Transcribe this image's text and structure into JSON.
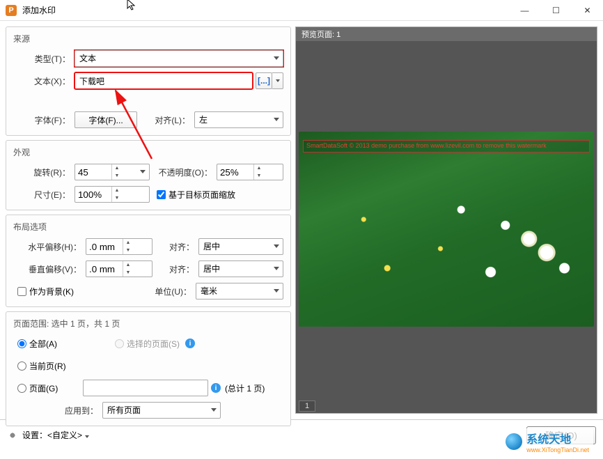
{
  "window": {
    "title": "添加水印",
    "icon_letter": "P",
    "minimize": "—",
    "maximize": "☐",
    "close": "✕"
  },
  "source": {
    "group": "来源",
    "type_label": "类型(T)：",
    "type_value": "文本",
    "text_label": "文本(X)：",
    "text_value": "下载吧",
    "ext_btn": "[...]",
    "font_label": "字体(F)：",
    "font_btn": "字体(F)...",
    "align_label": "对齐(L)：",
    "align_value": "左"
  },
  "appearance": {
    "group": "外观",
    "rotate_label": "旋转(R)：",
    "rotate_value": "45",
    "opacity_label": "不透明度(O)：",
    "opacity_value": "25%",
    "size_label": "尺寸(E)：",
    "size_value": "100%",
    "scale_check": "基于目标页面缩放",
    "scale_checked": true
  },
  "layout": {
    "group": "布局选项",
    "hoffset_label": "水平偏移(H)：",
    "hoffset_value": ".0 mm",
    "voffset_label": "垂直偏移(V)：",
    "voffset_value": ".0 mm",
    "halign_label": "对齐：",
    "halign_value": "居中",
    "valign_label": "对齐：",
    "valign_value": "居中",
    "bg_check": "作为背景(K)",
    "bg_checked": false,
    "unit_label": "单位(U)：",
    "unit_value": "毫米"
  },
  "range": {
    "group": "页面范围: 选中 1 页，共 1 页",
    "all": "全部(A)",
    "current": "当前页(R)",
    "pages": "页面(G)",
    "selected": "选择的页面(S)",
    "pages_value": "",
    "pages_hint": "(总计 1 页)",
    "apply_label": "应用到：",
    "apply_value": "所有页面",
    "checked": "all"
  },
  "preview": {
    "header": "预览页面: 1",
    "watermark_text": "SmartDataSoft © 2013 demo purchase from www.lizevil.com to remove this watermark",
    "page_num": "1"
  },
  "footer": {
    "settings_label": "设置：<自定义>",
    "ok": "确定(O)"
  },
  "branding": {
    "name": "系统天地",
    "url": "www.XiTongTianDi.net"
  }
}
